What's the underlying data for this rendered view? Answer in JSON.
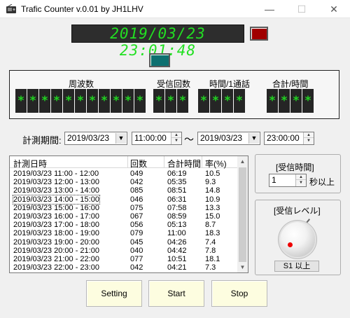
{
  "window": {
    "title": "Trafic Counter v.0.01 by JH1LHV",
    "minimize_glyph": "—",
    "maximize_glyph": "☐",
    "close_glyph": "✕"
  },
  "clock": {
    "datetime": "2019/03/23 23:01:48"
  },
  "indicators": {
    "red_led_color": "#a00000",
    "teal_led_color": "#0e7070"
  },
  "counters": {
    "frequency_label": "周波数",
    "frequency_digits": [
      "*",
      "*",
      "*",
      "*",
      "*",
      "*",
      "*",
      "*",
      "*",
      "*",
      "*"
    ],
    "received_count_label": "受信回数",
    "received_count_digits": [
      "*",
      "*",
      "*"
    ],
    "time_per_call_label": "時間/1通話",
    "time_per_call_digits": [
      "*",
      "*",
      "*",
      "*"
    ],
    "total_time_label": "合計/時間",
    "total_time_digits": [
      "*",
      "*",
      "*",
      "*"
    ]
  },
  "period": {
    "label": "計測期間:",
    "start_date": "2019/03/23",
    "start_time": "11:00:00",
    "separator": "～",
    "end_date": "2019/03/23",
    "end_time": "23:00:00"
  },
  "log": {
    "headers": [
      "計測日時",
      "回数",
      "合計時間",
      "率(%)"
    ],
    "rows": [
      [
        "2019/03/23 11:00 - 12:00",
        "049",
        "06:19",
        "10.5"
      ],
      [
        "2019/03/23 12:00 - 13:00",
        "042",
        "05:35",
        "9.3"
      ],
      [
        "2019/03/23 13:00 - 14:00",
        "085",
        "08:51",
        "14.8"
      ],
      [
        "2019/03/23 14:00 - 15:00",
        "046",
        "06:31",
        "10.9"
      ],
      [
        "2019/03/23 15:00 - 16:00",
        "075",
        "07:58",
        "13.3"
      ],
      [
        "2019/03/23 16:00 - 17:00",
        "067",
        "08:59",
        "15.0"
      ],
      [
        "2019/03/23 17:00 - 18:00",
        "056",
        "05:13",
        "8.7"
      ],
      [
        "2019/03/23 18:00 - 19:00",
        "079",
        "11:00",
        "18.3"
      ],
      [
        "2019/03/23 19:00 - 20:00",
        "045",
        "04:26",
        "7.4"
      ],
      [
        "2019/03/23 20:00 - 21:00",
        "040",
        "04:42",
        "7.8"
      ],
      [
        "2019/03/23 21:00 - 22:00",
        "077",
        "10:51",
        "18.1"
      ],
      [
        "2019/03/23 22:00 - 23:00",
        "042",
        "04:21",
        "7.3"
      ]
    ]
  },
  "receive_time": {
    "title": "[受信時間]",
    "value": "1",
    "suffix": "秒以上"
  },
  "receive_level": {
    "title": "[受信レベル]",
    "level": "S1 以上"
  },
  "buttons": {
    "setting": "Setting",
    "start": "Start",
    "stop": "Stop"
  }
}
